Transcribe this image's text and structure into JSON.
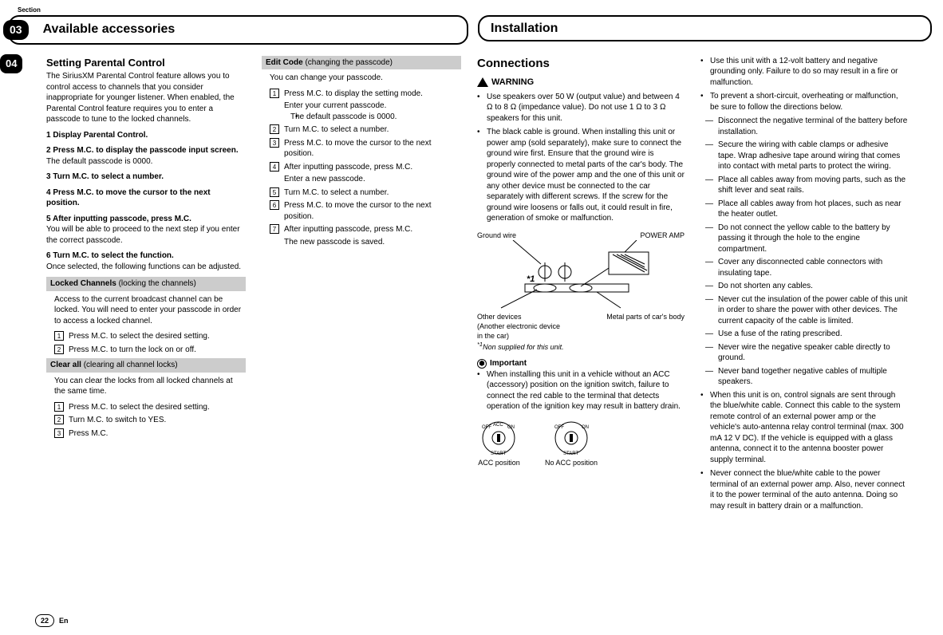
{
  "section_label": "Section",
  "headers": {
    "left_num": "03",
    "left_title": "Available accessories",
    "right_title": "Installation"
  },
  "side_tab": "04",
  "col1": {
    "title": "Setting Parental Control",
    "intro": "The SiriusXM Parental Control feature allows you to control access to channels that you consider inappropriate for younger listener. When enabled, the Parental Control feature requires you to enter a passcode to tune to the locked channels.",
    "steps": [
      {
        "head": "1    Display Parental Control."
      },
      {
        "head": "2    Press M.C. to display the passcode input screen.",
        "body": "The default passcode is 0000."
      },
      {
        "head": "3    Turn M.C. to select a number."
      },
      {
        "head": "4    Press M.C. to move the cursor to the next position."
      },
      {
        "head": "5    After inputting passcode, press M.C.",
        "body": "You will be able to proceed to the next step if you enter the correct passcode."
      },
      {
        "head": "6    Turn M.C. to select the function.",
        "body": "Once selected, the following functions can be adjusted."
      }
    ],
    "locked_head": "Locked Channels",
    "locked_head_light": " (locking the channels)",
    "locked_intro": "Access to the current broadcast channel can be locked. You will need to enter your passcode in order to access a locked channel.",
    "locked_steps": [
      "Press M.C. to select the desired setting.",
      "Press M.C. to turn the lock on or off."
    ],
    "clear_head": "Clear all",
    "clear_head_light": " (clearing all channel locks)",
    "clear_intro": "You can clear the locks from all locked channels at the same time.",
    "clear_steps": [
      "Press M.C. to select the desired setting.",
      "Turn M.C. to switch to YES.",
      "Press M.C."
    ]
  },
  "col2": {
    "edit_head": "Edit Code",
    "edit_head_light": " (changing the passcode)",
    "edit_intro": "You can change your passcode.",
    "edit_steps": [
      {
        "t": "Press M.C. to display the setting mode.",
        "sub1": "Enter your current passcode.",
        "sub2": "The default passcode is 0000."
      },
      {
        "t": "Turn M.C. to select a number."
      },
      {
        "t": "Press M.C. to move the cursor to the next position."
      },
      {
        "t": "After inputting passcode, press M.C.",
        "sub1": "Enter a new passcode."
      },
      {
        "t": "Turn M.C. to select a number."
      },
      {
        "t": "Press M.C. to move the cursor to the next position."
      },
      {
        "t": "After inputting passcode, press M.C.",
        "sub1": "The new passcode is saved."
      }
    ]
  },
  "col3": {
    "title": "Connections",
    "warning_label": "WARNING",
    "warnings": [
      "Use speakers over 50 W (output value) and between 4 Ω to 8 Ω (impedance value). Do not use 1 Ω to 3 Ω speakers for this unit.",
      "The black cable is ground. When installing this unit or power amp (sold separately), make sure to connect the ground wire first. Ensure that the ground wire is properly connected to metal parts of the car's body. The ground wire of the power amp and the one of this unit or any other device must be connected to the car separately with different screws. If the screw for the ground wire loosens or falls out, it could result in fire, generation of smoke or malfunction."
    ],
    "fig": {
      "ground_wire": "Ground wire",
      "power_amp": "POWER AMP",
      "other_devices": "Other devices",
      "other_devices_sub": "(Another electronic device in the car)",
      "metal_parts": "Metal parts of car's body",
      "star1": "*1",
      "note": "Non supplied for this unit.",
      "note_prefix": "*1"
    },
    "important_label": "Important",
    "important": "When installing this unit in a vehicle without an ACC (accessory) position on the ignition switch, failure to connect the red cable to the terminal that detects operation of the ignition key may result in battery drain.",
    "acc_pos": "ACC position",
    "no_acc_pos": "No ACC position"
  },
  "col4": {
    "bullets": [
      "Use this unit with a 12-volt battery and negative grounding only. Failure to do so may result in a fire or malfunction.",
      "To prevent a short-circuit, overheating or malfunction, be sure to follow the directions below."
    ],
    "dashes": [
      "Disconnect the negative terminal of the battery before installation.",
      "Secure the wiring with cable clamps or adhesive tape. Wrap adhesive tape around wiring that comes into contact with metal parts to protect the wiring.",
      "Place all cables away from moving parts, such as the shift lever and seat rails.",
      "Place all cables away from hot places, such as near the heater outlet.",
      "Do not connect the yellow cable to the battery by passing it through the hole to the engine compartment.",
      "Cover any disconnected cable connectors with insulating tape.",
      "Do not shorten any cables.",
      "Never cut the insulation of the power cable of this unit in order to share the power with other devices. The current capacity of the cable is limited.",
      "Use a fuse of the rating prescribed.",
      "Never wire the negative speaker cable directly to ground.",
      "Never band together negative cables of multiple speakers."
    ],
    "bullets2": [
      "When this unit is on, control signals are sent through the blue/white cable. Connect this cable to the system remote control of an external power amp or the vehicle's auto-antenna relay control terminal (max. 300 mA 12 V DC). If the vehicle is equipped with a glass antenna, connect it to the antenna booster power supply terminal.",
      "Never connect the blue/white cable to the power terminal of an external power amp. Also, never connect it to the power terminal of the auto antenna. Doing so may result in battery drain or a malfunction."
    ]
  },
  "footer": {
    "page": "22",
    "lang": "En"
  }
}
